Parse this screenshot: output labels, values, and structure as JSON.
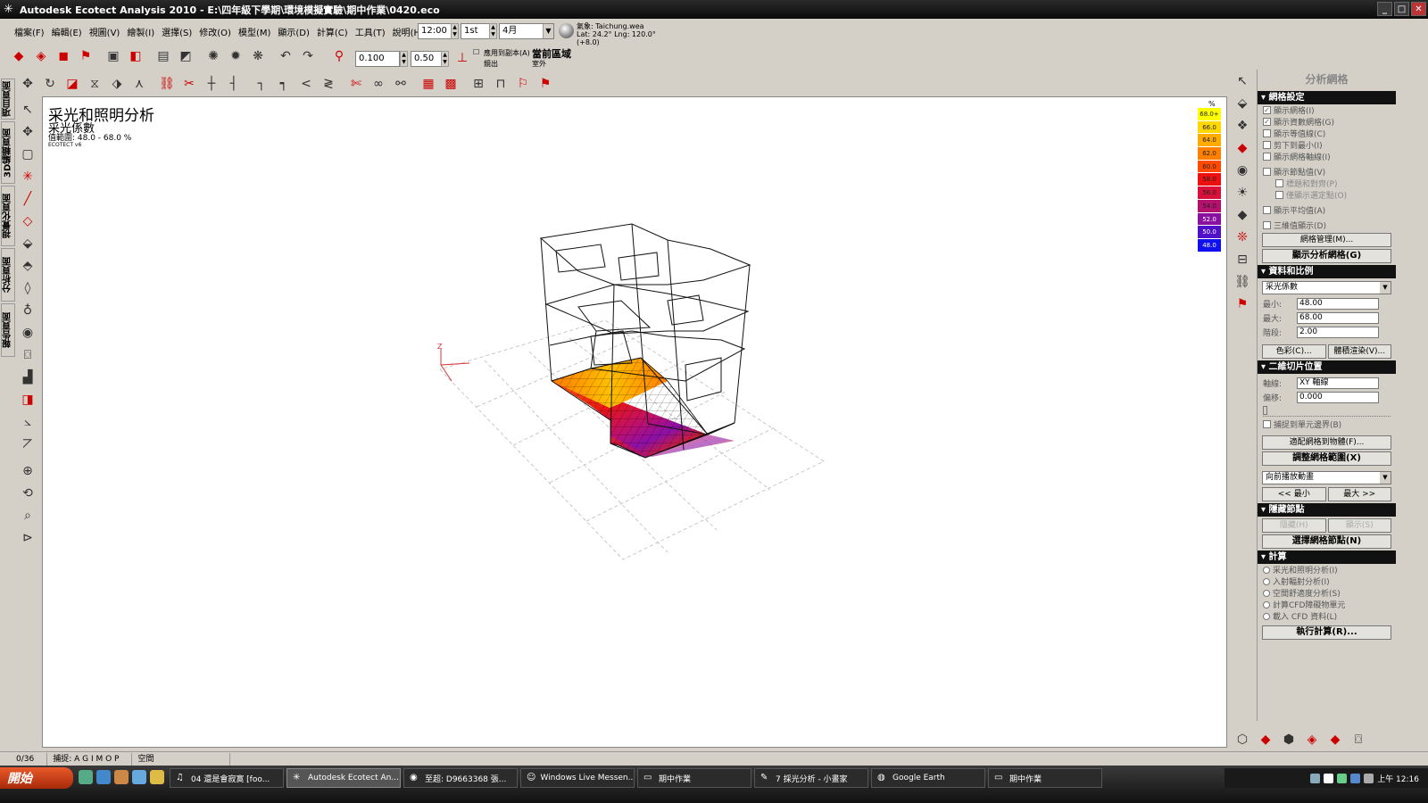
{
  "window": {
    "title": "Autodesk Ecotect Analysis 2010 - E:\\四年級下學期\\環境模擬實驗\\期中作業\\0420.eco",
    "minimize": "_",
    "maximize": "□",
    "close": "✕"
  },
  "menu": {
    "items": [
      "檔案(F)",
      "編輯(E)",
      "視圖(V)",
      "繪製(I)",
      "選擇(S)",
      "修改(O)",
      "模型(M)",
      "顯示(D)",
      "計算(C)",
      "工具(T)",
      "說明(H)"
    ]
  },
  "time": {
    "hour": "12:00",
    "day": "1st",
    "month": "4月"
  },
  "weather": {
    "file": "氣象: Taichung.wea",
    "coords": "Lat: 24.2°  Lng: 120.0°(+8.0)"
  },
  "toolbar2": {
    "grid_value": "0.100",
    "snap_value": "0.50",
    "apply_label": "應用到副本(A)",
    "mirror_label": "鏡出",
    "current_zone": "當前區域",
    "outside": "室外"
  },
  "vtabs": [
    "項目頁面",
    "3D編輯頁面",
    "視覺化頁面",
    "分析頁面",
    "報告頁面"
  ],
  "viewport": {
    "title": "采光和照明分析",
    "subtitle": "采光係數",
    "range": "值範圍: 48.0 - 68.0 %",
    "version": "ECOTECT v6"
  },
  "legend": {
    "unit": "%",
    "entries": [
      {
        "label": "68.0+",
        "color": "#ffff00"
      },
      {
        "label": "66.0",
        "color": "#ffd800"
      },
      {
        "label": "64.0",
        "color": "#ffab00"
      },
      {
        "label": "62.0",
        "color": "#ff8000"
      },
      {
        "label": "60.0",
        "color": "#ff4a00"
      },
      {
        "label": "58.0",
        "color": "#ee1010"
      },
      {
        "label": "56.0",
        "color": "#d8103a"
      },
      {
        "label": "54.0",
        "color": "#b4106e"
      },
      {
        "label": "52.0",
        "color": "#8a10a0"
      },
      {
        "label": "50.0",
        "color": "#5010c8"
      },
      {
        "label": "48.0",
        "color": "#1010ee"
      }
    ]
  },
  "panel": {
    "title": "分析網格",
    "grid_settings": {
      "header": "網格設定",
      "show_grid": "顯示網格(I)",
      "show_data_grid": "顯示資數網格(G)",
      "show_contours": "顯示等值線(C)",
      "clip_to_min": "剪下到最小(I)",
      "show_grid_axes": "顯示網格軸線(I)",
      "show_node_values": "顯示節點值(V)",
      "label_and_align": "標題和對齊(P)",
      "show_selected_only": "僅顯示選定點(O)",
      "show_average": "顯示平均值(A)",
      "show_3d": "三維值顯示(D)",
      "grid_manage": "網格管理(M)...",
      "show_analysis_grid": "顯示分析網格(G)"
    },
    "data_scale": {
      "header": "資料和比例",
      "selected": "采光係數",
      "min_label": "最小:",
      "min_value": "48.00",
      "max_label": "最大:",
      "max_value": "68.00",
      "step_label": "階段:",
      "step_value": "2.00",
      "color_btn": "色彩(C)...",
      "volume_btn": "體積渲染(V)..."
    },
    "slice": {
      "header": "二維切片位置",
      "axis_label": "軸線:",
      "axis_value": "XY 軸線",
      "offset_label": "偏移:",
      "offset_value": "0.000",
      "snap_cells": "捕捉到單元邊界(B)"
    },
    "fit_grid": "適配網格到物體(F)...",
    "adjust_grid": "調整網格範圍(X)",
    "play_select": "向前播放動畫",
    "min_btn": "<< 最小",
    "max_btn": "最大 >>",
    "hidden": {
      "header": "隱藏節點",
      "hide": "隱藏(H)",
      "show": "顯示(S)",
      "select_nodes": "選擇網格節點(N)"
    },
    "calc": {
      "header": "計算",
      "options": [
        "采光和照明分析(I)",
        "入射輻射分析(I)",
        "空間舒適度分析(S)",
        "計算CFD障礙物單元",
        "載入 CFD 資料(L)"
      ],
      "run": "執行計算(R)..."
    }
  },
  "status": {
    "count": "0/36",
    "snap": "捕捉: A  G I  M O P",
    "mode": "空間"
  },
  "taskbar": {
    "start": "開始",
    "tasks": [
      "04 還是會寂寞 [foo...",
      "Autodesk Ecotect An...",
      "至超: D9663368 張...",
      "Windows Live Messen...",
      "期中作業",
      "7 採光分析 - 小畫家",
      "Google Earth",
      "期中作業"
    ],
    "clock": "上午 12:16"
  }
}
